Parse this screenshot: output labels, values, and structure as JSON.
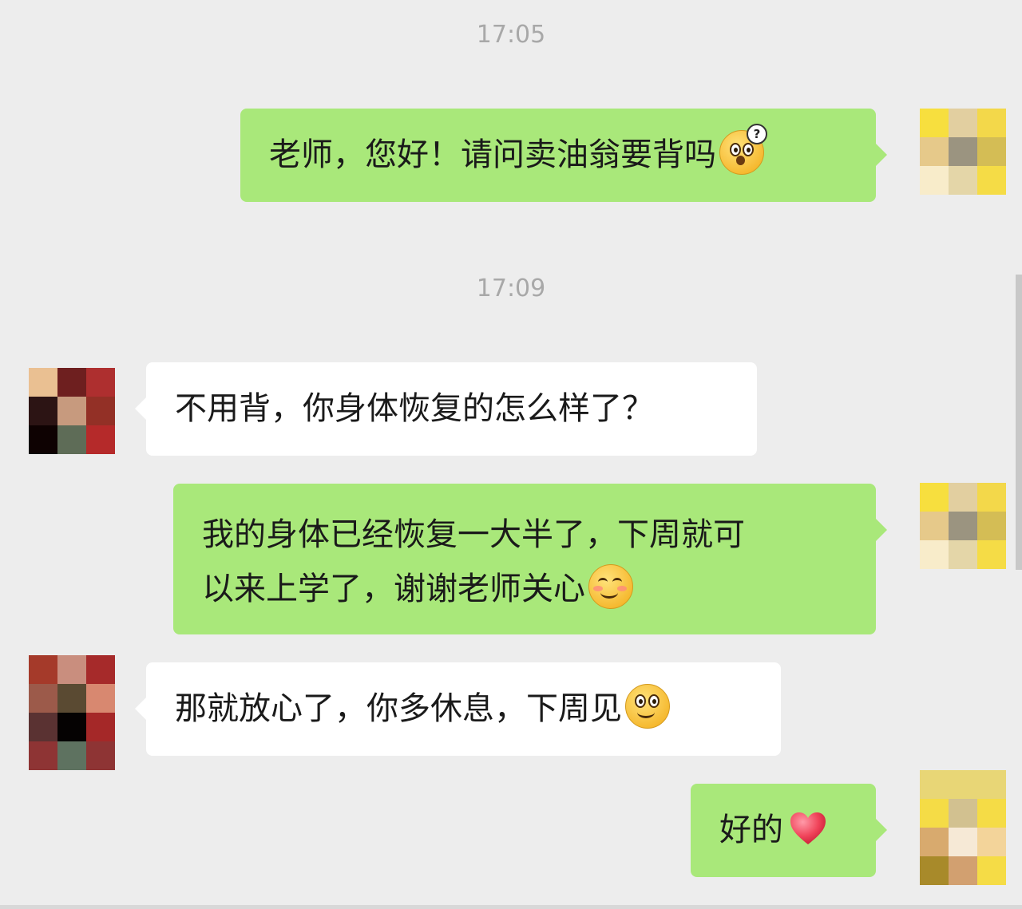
{
  "timestamps": [
    "17:05",
    "17:09"
  ],
  "messages": [
    {
      "sender": "me",
      "text": "老师，您好！请问卖油翁要背吗",
      "emoji": "confused-face-icon"
    },
    {
      "sender": "teacher",
      "text": "不用背，你身体恢复的怎么样了？"
    },
    {
      "sender": "me",
      "line1": "我的身体已经恢复一大半了，下周就可",
      "line2": "以来上学了，谢谢老师关心",
      "emoji": "blushing-smile-icon"
    },
    {
      "sender": "teacher",
      "text": "那就放心了，你多休息，下周见",
      "emoji": "smile-icon"
    },
    {
      "sender": "me",
      "text": "好的",
      "emoji": "heart-icon"
    }
  ],
  "colors": {
    "background": "#ededed",
    "my_bubble": "#a9e87a",
    "their_bubble": "#ffffff",
    "timestamp": "#a8a8a8"
  },
  "avatars": {
    "me_pixels": [
      "#f7df3e",
      "#e2cfa0",
      "#f3d84a",
      "#e6c98a",
      "#9b9480",
      "#d4bd55",
      "#f8ecca",
      "#e4d6a8",
      "#f5dc46"
    ],
    "teacher_pixels": [
      "#eac092",
      "#6e1f1f",
      "#ae2f2f",
      "#2c1414",
      "#c79a7e",
      "#933026",
      "#0e0202",
      "#5e6c57",
      "#b52a2a"
    ],
    "teacher2_pixels": [
      "#a53a2a",
      "#c98e7e",
      "#a62a2a",
      "#9c5a4a",
      "#5a4a32",
      "#d88870",
      "#5a3232",
      "#050202",
      "#a52828",
      "#8e3434",
      "#5e7260",
      "#8e3434"
    ],
    "me3_pixels": [
      "#e8d676",
      "#e8d676",
      "#e8d676",
      "#f5dc46",
      "#d2c190",
      "#f5dc46",
      "#d8aa6e",
      "#f6e9d6",
      "#f3d49a",
      "#a88a2a",
      "#d2a070",
      "#f5dc46"
    ]
  }
}
